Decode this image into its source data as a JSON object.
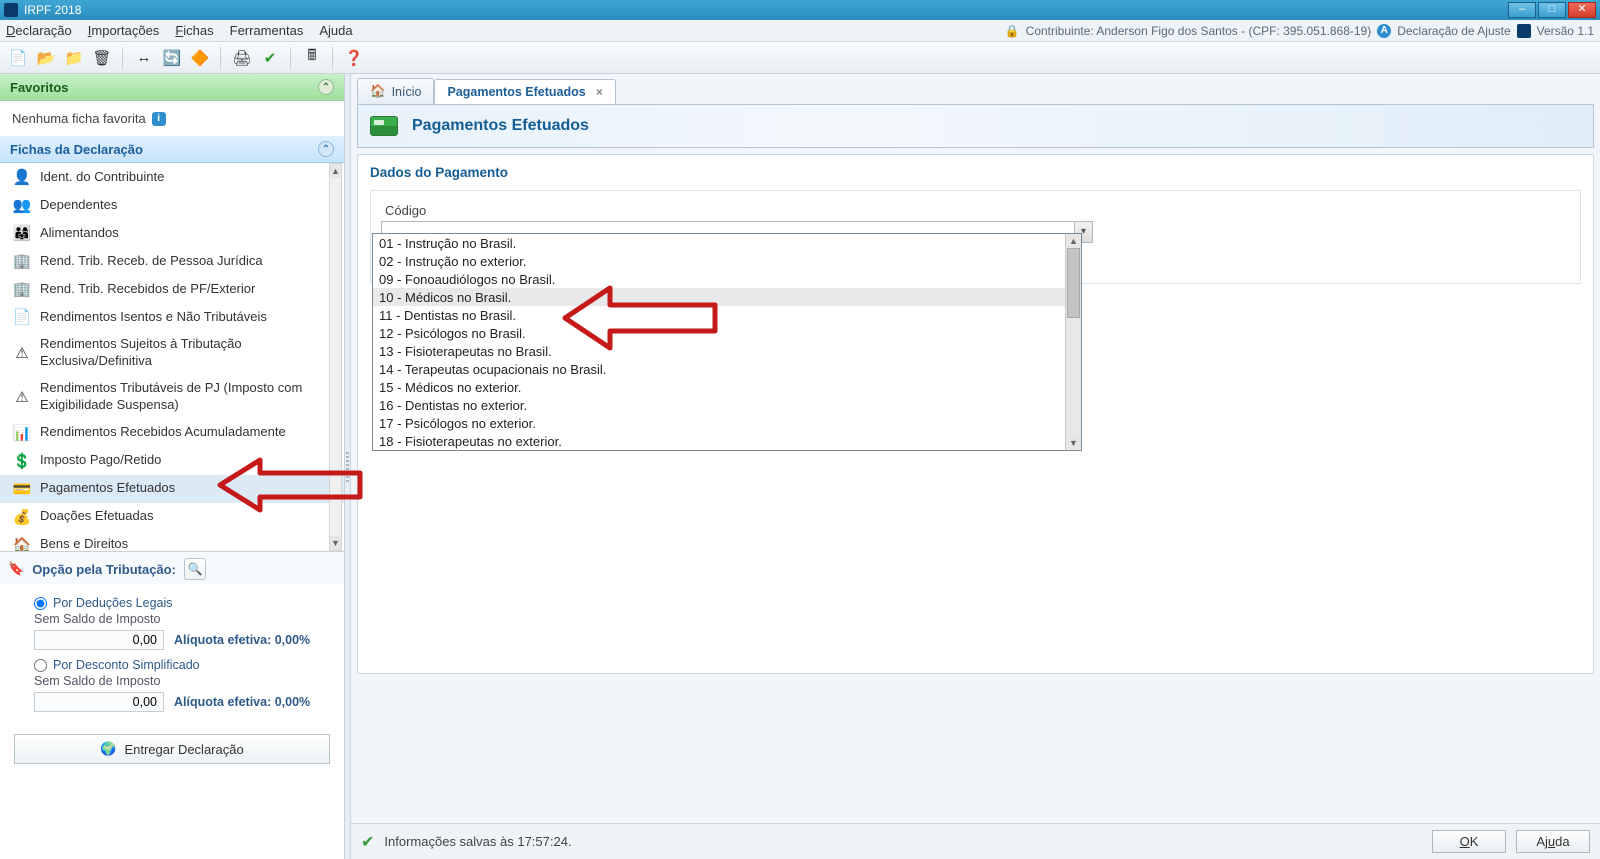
{
  "app": {
    "title": "IRPF 2018"
  },
  "window_controls": {
    "min": "–",
    "max": "□",
    "close": "✕"
  },
  "menubar": {
    "items": [
      "Declaração",
      "Importações",
      "Fichas",
      "Ferramentas",
      "Ajuda"
    ],
    "contribuinte_label": "Contribuinte: Anderson Figo dos Santos - (CPF: 395.051.868-19)",
    "ajuste_label": "Declaração de Ajuste",
    "version_label": "Versão 1.1"
  },
  "toolbar": {
    "icons": [
      "📄",
      "📂",
      "📁",
      "🗑",
      "↔",
      "🔄",
      "🔶",
      "🖨",
      "✔",
      "🖩",
      "❓"
    ]
  },
  "sidebar": {
    "favoritos_title": "Favoritos",
    "favoritos_empty": "Nenhuma ficha favorita",
    "fichas_title": "Fichas da Declaração",
    "items": [
      {
        "icon": "👤",
        "label": "Ident. do Contribuinte"
      },
      {
        "icon": "👥",
        "label": "Dependentes"
      },
      {
        "icon": "👨‍👩‍👧",
        "label": "Alimentandos"
      },
      {
        "icon": "🏢",
        "label": "Rend. Trib. Receb. de Pessoa Jurídica"
      },
      {
        "icon": "🏢",
        "label": "Rend. Trib. Recebidos de PF/Exterior"
      },
      {
        "icon": "📄",
        "label": "Rendimentos Isentos e Não Tributáveis"
      },
      {
        "icon": "⚠",
        "label": "Rendimentos Sujeitos à Tributação Exclusiva/Definitiva"
      },
      {
        "icon": "⚠",
        "label": "Rendimentos Tributáveis de PJ (Imposto com Exigibilidade Suspensa)"
      },
      {
        "icon": "📊",
        "label": "Rendimentos Recebidos Acumuladamente"
      },
      {
        "icon": "💲",
        "label": "Imposto Pago/Retido"
      },
      {
        "icon": "💳",
        "label": "Pagamentos Efetuados",
        "selected": true
      },
      {
        "icon": "💰",
        "label": "Doações Efetuadas"
      },
      {
        "icon": "🏠",
        "label": "Bens e Direitos"
      }
    ],
    "opcao_title": "Opção pela Tributação:",
    "radio1": "Por Deduções Legais",
    "sub1": "Sem Saldo de Imposto",
    "val1": "0,00",
    "aliq1": "Alíquota efetiva: 0,00%",
    "radio2": "Por Desconto Simplificado",
    "sub2": "Sem Saldo de Imposto",
    "val2": "0,00",
    "aliq2": "Alíquota efetiva: 0,00%",
    "entregar": "Entregar Declaração"
  },
  "tabs": {
    "inicio": "Início",
    "active": "Pagamentos Efetuados"
  },
  "page": {
    "title": "Pagamentos Efetuados",
    "section": "Dados do Pagamento",
    "field_codigo": "Código"
  },
  "dropdown": {
    "items": [
      "01 - Instrução no Brasil.",
      "02 - Instrução no exterior.",
      "09 - Fonoaudiólogos no Brasil.",
      "10 - Médicos no Brasil.",
      "11 - Dentistas no Brasil.",
      "12 - Psicólogos no Brasil.",
      "13 - Fisioterapeutas no Brasil.",
      "14 - Terapeutas ocupacionais no Brasil.",
      "15 - Médicos no exterior.",
      "16 - Dentistas no exterior.",
      "17 - Psicólogos no exterior.",
      "18 - Fisioterapeutas no exterior."
    ],
    "hover_index": 3
  },
  "footer": {
    "msg": "Informações salvas às 17:57:24.",
    "ok": "OK",
    "ajuda": "Ajuda"
  }
}
